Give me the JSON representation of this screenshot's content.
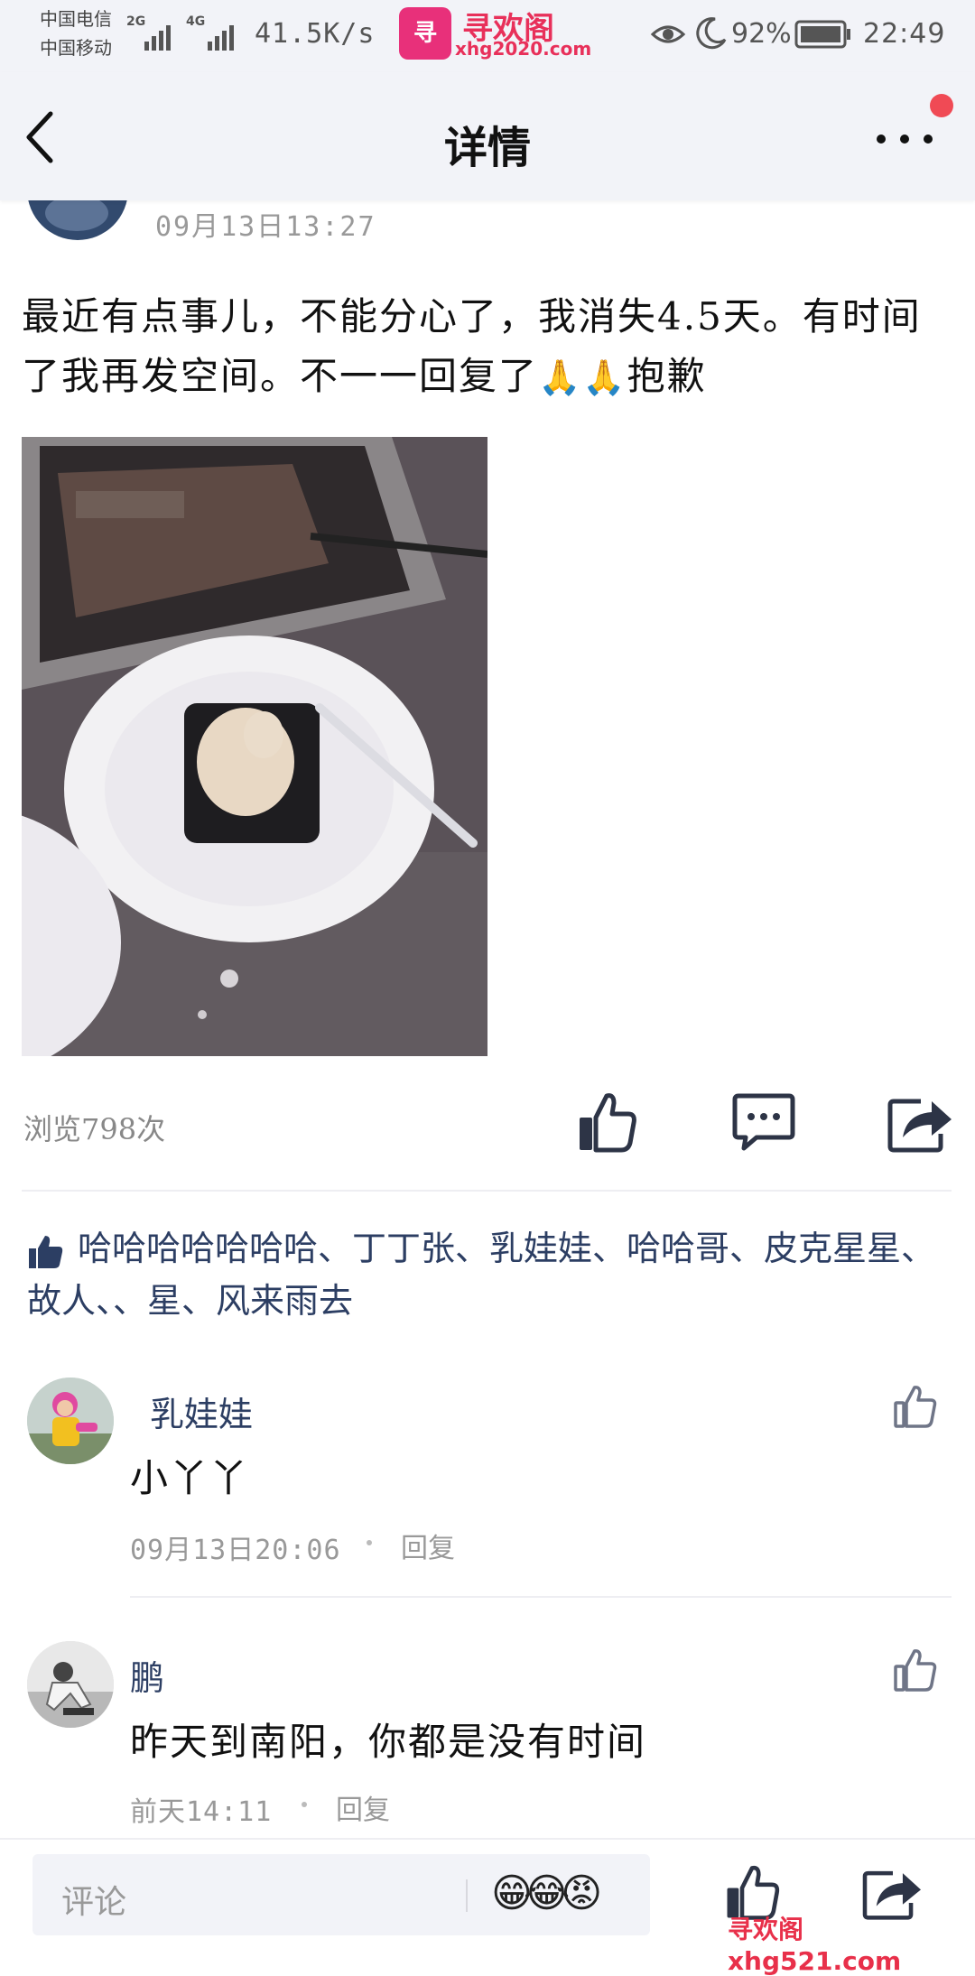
{
  "status_bar": {
    "carrier_1": "中国电信",
    "carrier_2": "中国移动",
    "net_2g": "2G",
    "net_4g": "4G",
    "net_speed": "41.5K/s",
    "app_logo_name": "寻欢阁",
    "app_logo_url": "xhg2020.com",
    "battery": "92%",
    "time": "22:49",
    "icons": [
      "eye-icon",
      "moon-icon",
      "battery-icon"
    ]
  },
  "header": {
    "title": "详情",
    "back_icon": "chevron-left-icon",
    "more_icon": "more-dots-icon"
  },
  "post": {
    "timestamp": "09月13日13:27",
    "text": "最近有点事儿，不能分心了，我消失4.5天。有时间了我再发空间。不一一回复了",
    "emoji": "🙏🙏",
    "text_end": "抱歉",
    "views": "浏览798次"
  },
  "likes": {
    "names": "哈哈哈哈哈哈哈、丁丁张、乳娃娃、哈哈哥、皮克星星、故人、、星、风来雨去"
  },
  "comments": [
    {
      "name": "乳娃娃",
      "text": "小丫丫",
      "time": "09月13日20:06",
      "reply": "回复"
    },
    {
      "name": "鹏",
      "text": "昨天到南阳，你都是没有时间",
      "time": "前天14:11",
      "reply": "回复"
    }
  ],
  "bottom_bar": {
    "comment_placeholder": "评论",
    "emoji": "😁😂😡",
    "watermark": "寻欢阁xhg521.com"
  },
  "colors": {
    "header_bg": "#f2f3f8",
    "name_blue": "#2c3e63",
    "icon_dark": "#2d3446",
    "badge_red": "#f04a55"
  }
}
